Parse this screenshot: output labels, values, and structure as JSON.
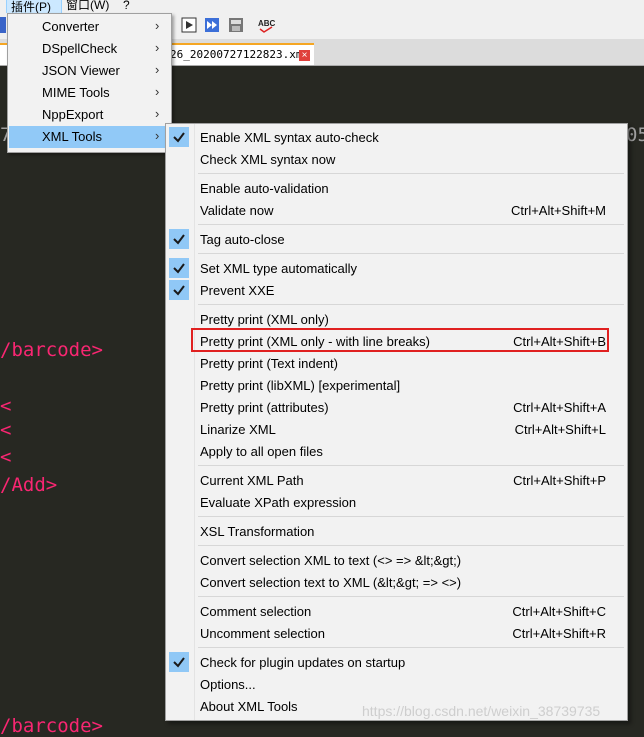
{
  "menubar": {
    "plugins_label": "插件(P)",
    "window_label": "窗口(W)",
    "help_label": "?"
  },
  "tab": {
    "label": "26_20200727122823.xml",
    "close": "×"
  },
  "editor": {
    "lines": [
      "/barcode>",
      "<",
      "<",
      "<",
      "/Add>",
      "/barcode>"
    ],
    "left_fragment_1": "7",
    "right_fragment_1": "05"
  },
  "plugins_submenu": {
    "items": [
      {
        "label": "Converter",
        "arrow": "›"
      },
      {
        "label": "DSpellCheck",
        "arrow": "›"
      },
      {
        "label": "JSON Viewer",
        "arrow": "›"
      },
      {
        "label": "MIME Tools",
        "arrow": "›"
      },
      {
        "label": "NppExport",
        "arrow": "›"
      },
      {
        "label": "XML Tools",
        "arrow": "›"
      }
    ],
    "active_index": 5
  },
  "xml_tools_menu": {
    "items": [
      {
        "label": "Enable XML syntax auto-check",
        "shortcut": "",
        "checked": true
      },
      {
        "label": "Check XML syntax now",
        "shortcut": "",
        "checked": false
      },
      {
        "label": "Enable auto-validation",
        "shortcut": "",
        "checked": false
      },
      {
        "label": "Validate now",
        "shortcut": "Ctrl+Alt+Shift+M",
        "checked": false
      },
      {
        "label": "Tag auto-close",
        "shortcut": "",
        "checked": true
      },
      {
        "label": "Set XML type automatically",
        "shortcut": "",
        "checked": true
      },
      {
        "label": "Prevent XXE",
        "shortcut": "",
        "checked": true
      },
      {
        "label": "Pretty print (XML only)",
        "shortcut": "",
        "checked": false
      },
      {
        "label": "Pretty print (XML only - with line breaks)",
        "shortcut": "Ctrl+Alt+Shift+B",
        "checked": false
      },
      {
        "label": "Pretty print (Text indent)",
        "shortcut": "",
        "checked": false
      },
      {
        "label": "Pretty print (libXML) [experimental]",
        "shortcut": "",
        "checked": false
      },
      {
        "label": "Pretty print (attributes)",
        "shortcut": "Ctrl+Alt+Shift+A",
        "checked": false
      },
      {
        "label": "Linarize XML",
        "shortcut": "Ctrl+Alt+Shift+L",
        "checked": false
      },
      {
        "label": "Apply to all open files",
        "shortcut": "",
        "checked": false
      },
      {
        "label": "Current XML Path",
        "shortcut": "Ctrl+Alt+Shift+P",
        "checked": false
      },
      {
        "label": "Evaluate XPath expression",
        "shortcut": "",
        "checked": false
      },
      {
        "label": "XSL Transformation",
        "shortcut": "",
        "checked": false
      },
      {
        "label": "Convert selection XML to text (<> => &lt;&gt;)",
        "shortcut": "",
        "checked": false
      },
      {
        "label": "Convert selection text to XML (&lt;&gt; => <>)",
        "shortcut": "",
        "checked": false
      },
      {
        "label": "Comment selection",
        "shortcut": "Ctrl+Alt+Shift+C",
        "checked": false
      },
      {
        "label": "Uncomment selection",
        "shortcut": "Ctrl+Alt+Shift+R",
        "checked": false
      },
      {
        "label": "Check for plugin updates on startup",
        "shortcut": "",
        "checked": true
      },
      {
        "label": "Options...",
        "shortcut": "",
        "checked": false
      },
      {
        "label": "About XML Tools",
        "shortcut": "",
        "checked": false
      }
    ],
    "highlighted_index": 8
  },
  "watermark": "https://blog.csdn.net/weixin_38739735",
  "colors": {
    "editor_bg": "#272822",
    "code_pink": "#f92672",
    "check_bg": "#90c8f6",
    "highlight_box": "#e02020"
  }
}
